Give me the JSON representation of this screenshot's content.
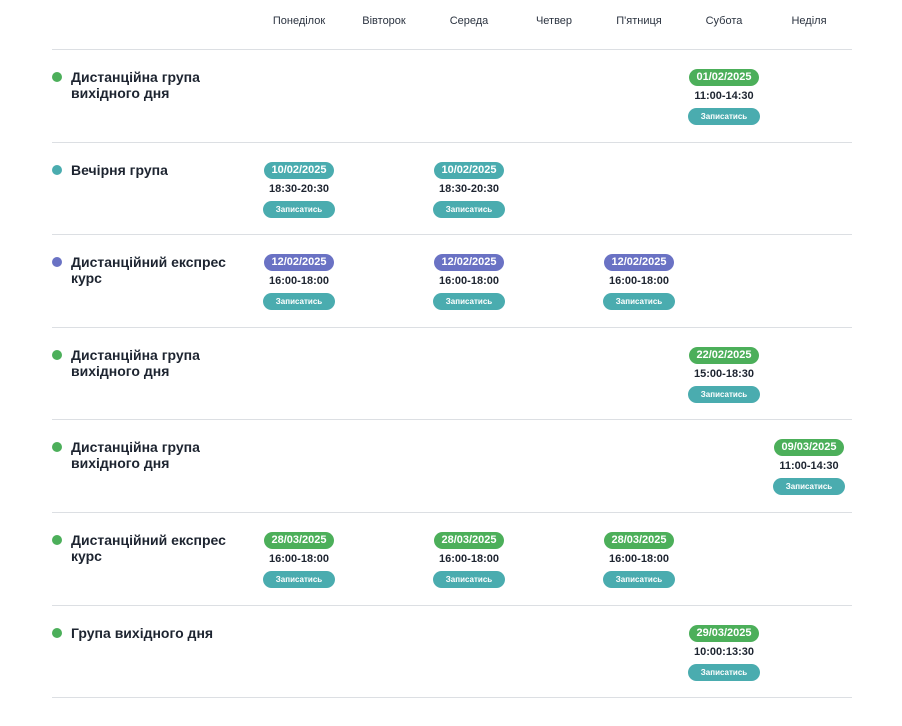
{
  "colors": {
    "green": "#4caf5a",
    "teal": "#4aacaf",
    "purple": "#6a72c4",
    "button": "#4aacaf"
  },
  "days": [
    "Понеділок",
    "Вівторок",
    "Середа",
    "Четвер",
    "П'ятниця",
    "Субота",
    "Неділя"
  ],
  "button_label": "Записатись",
  "rows": [
    {
      "title": "Дистанційна група вихідного дня",
      "dot": "green",
      "sessions": [
        {
          "day": 5,
          "date": "01/02/2025",
          "time": "11:00-14:30",
          "color": "green"
        }
      ]
    },
    {
      "title": "Вечірня група",
      "dot": "teal",
      "sessions": [
        {
          "day": 0,
          "date": "10/02/2025",
          "time": "18:30-20:30",
          "color": "teal"
        },
        {
          "day": 2,
          "date": "10/02/2025",
          "time": "18:30-20:30",
          "color": "teal"
        }
      ]
    },
    {
      "title": "Дистанційний експрес курс",
      "dot": "purple",
      "sessions": [
        {
          "day": 0,
          "date": "12/02/2025",
          "time": "16:00-18:00",
          "color": "purple"
        },
        {
          "day": 2,
          "date": "12/02/2025",
          "time": "16:00-18:00",
          "color": "purple"
        },
        {
          "day": 4,
          "date": "12/02/2025",
          "time": "16:00-18:00",
          "color": "purple"
        }
      ]
    },
    {
      "title": "Дистанційна група вихідного дня",
      "dot": "green",
      "sessions": [
        {
          "day": 5,
          "date": "22/02/2025",
          "time": "15:00-18:30",
          "color": "green"
        }
      ]
    },
    {
      "title": "Дистанційна група вихідного дня",
      "dot": "green",
      "sessions": [
        {
          "day": 6,
          "date": "09/03/2025",
          "time": "11:00-14:30",
          "color": "green"
        }
      ]
    },
    {
      "title": "Дистанційний експрес курс",
      "dot": "green",
      "sessions": [
        {
          "day": 0,
          "date": "28/03/2025",
          "time": "16:00-18:00",
          "color": "green"
        },
        {
          "day": 2,
          "date": "28/03/2025",
          "time": "16:00-18:00",
          "color": "green"
        },
        {
          "day": 4,
          "date": "28/03/2025",
          "time": "16:00-18:00",
          "color": "green"
        }
      ]
    },
    {
      "title": "Група вихідного дня",
      "dot": "green",
      "sessions": [
        {
          "day": 5,
          "date": "29/03/2025",
          "time": "10:00:13:30",
          "color": "green"
        }
      ]
    }
  ]
}
